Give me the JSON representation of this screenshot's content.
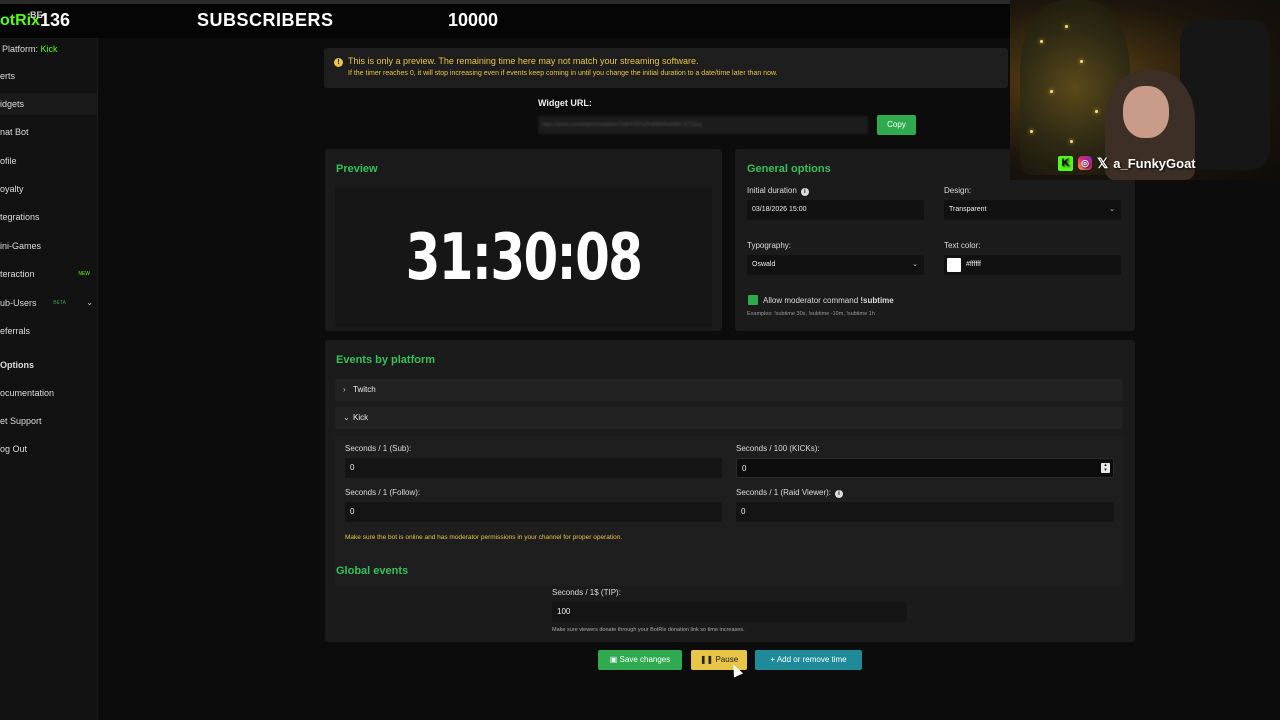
{
  "topbar": {
    "logo": "otRix",
    "logo_sup": "BE",
    "count": "136",
    "title": "SUBSCRIBERS",
    "goal": "10000"
  },
  "sidebar": {
    "platform_label": "Platform:",
    "platform_value": "Kick",
    "items": [
      {
        "label": "erts"
      },
      {
        "label": "idgets"
      },
      {
        "label": "nat Bot"
      },
      {
        "label": "ofile"
      },
      {
        "label": "oyalty"
      },
      {
        "label": "tegrations"
      },
      {
        "label": "ini-Games"
      },
      {
        "label": "teraction",
        "badge": "NEW"
      },
      {
        "label": "ub-Users",
        "badge": "BETA"
      },
      {
        "label": "eferrals"
      },
      {
        "label": "Options"
      },
      {
        "label": "ocumentation"
      },
      {
        "label": "et Support"
      },
      {
        "label": "og Out"
      }
    ]
  },
  "notice": {
    "line1": "This is only a preview. The remaining time here may not match your streaming software.",
    "line2": "If the timer reaches 0, it will stop increasing even if events keep coming in until you change the initial duration to a date/time later than now."
  },
  "widget": {
    "label": "Widget URL:",
    "url": "https://botrix.live/widgets/subathon?bid=FrBTk2FxM9Dt0wfMM-3ZTQwg",
    "copy": "Copy"
  },
  "preview": {
    "title": "Preview",
    "timer": "31:30:08"
  },
  "general": {
    "title": "General options",
    "initial_duration_label": "Initial duration",
    "initial_duration_value": "03/18/2026 15:00",
    "design_label": "Design:",
    "design_value": "Transparent",
    "typography_label": "Typography:",
    "typography_value": "Oswald",
    "text_color_label": "Text color:",
    "text_color_value": "#ffffff",
    "mod_cmd_label": "Allow moderator command",
    "mod_cmd_code": "!subtime",
    "examples": "Examples:  !subtime 30s,  !subtime -10m,  !subtime 1h"
  },
  "events": {
    "title": "Events by platform",
    "twitch_label": "Twitch",
    "kick_label": "Kick",
    "sub_label": "Seconds / 1 (Sub):",
    "sub_value": "0",
    "kicks_label": "Seconds / 100 (KICKs):",
    "kicks_value": "0",
    "follow_label": "Seconds / 1 (Follow):",
    "follow_value": "0",
    "raid_label": "Seconds / 1 (Raid Viewer):",
    "raid_value": "0",
    "bot_warning": "Make sure the bot is online and has moderator permissions in your channel for proper operation.",
    "global_title": "Global events",
    "tip_label": "Seconds / 1$ (TIP):",
    "tip_value": "100",
    "tip_note": "Make sure viewers donate through your BotRix donation link so time increases."
  },
  "actions": {
    "save": "Save changes",
    "pause": "Pause",
    "add_remove": "Add or remove time"
  },
  "camera": {
    "handle": "a_FunkyGoat"
  }
}
